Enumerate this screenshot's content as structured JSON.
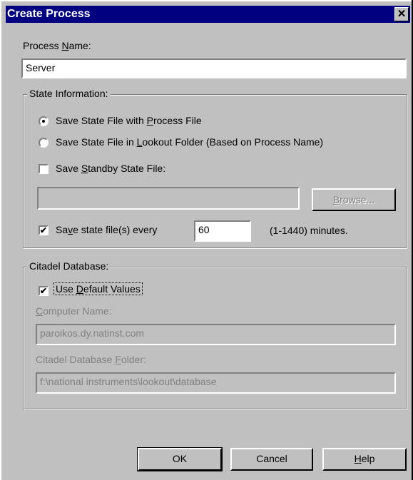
{
  "dialog": {
    "title": "Create Process",
    "close_glyph": "✕"
  },
  "process_name": {
    "label_pre": "Process ",
    "label_u": "N",
    "label_post": "ame:",
    "value": "Server"
  },
  "state_info": {
    "title": "State Information:",
    "radio1": {
      "pre": "Save State File with ",
      "u": "P",
      "post": "rocess File",
      "selected": true
    },
    "radio2": {
      "pre": "Save State File in ",
      "u": "L",
      "post": "ookout Folder (Based on Process Name)",
      "selected": false
    },
    "standby": {
      "pre": "Save ",
      "u": "S",
      "post": "tandby State File:",
      "checked": false
    },
    "standby_path": "",
    "browse": {
      "u": "B",
      "post": "rowse..."
    },
    "save_every": {
      "pre": "Sa",
      "u": "v",
      "post": "e state file(s) every",
      "checked": true,
      "value": "60",
      "range": "(1-1440) minutes."
    }
  },
  "citadel": {
    "title": "Citadel Database:",
    "use_default": {
      "pre": "Use ",
      "u": "D",
      "post": "efault Values",
      "checked": true
    },
    "computer_name": {
      "u": "C",
      "post": "omputer Name:",
      "value": "paroikos.dy.natinst.com"
    },
    "folder": {
      "pre": "Citadel Database ",
      "u": "F",
      "post": "older:",
      "value": "f:\\national instruments\\lookout\\database"
    }
  },
  "buttons": {
    "ok": "OK",
    "cancel": "Cancel",
    "help_u": "H",
    "help_post": "elp"
  },
  "check_glyph": "✔"
}
